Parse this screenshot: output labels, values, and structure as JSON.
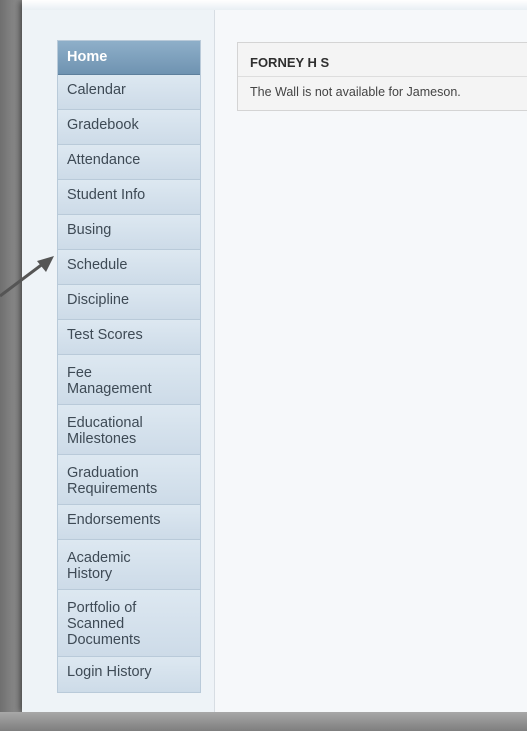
{
  "sidebar": {
    "items": [
      {
        "label": "Home",
        "active": true
      },
      {
        "label": "Calendar"
      },
      {
        "label": "Gradebook"
      },
      {
        "label": "Attendance"
      },
      {
        "label": "Student Info"
      },
      {
        "label": "Busing"
      },
      {
        "label": "Schedule"
      },
      {
        "label": "Discipline"
      },
      {
        "label": "Test Scores"
      },
      {
        "label": "Fee\nManagement"
      },
      {
        "label": "Educational\nMilestones"
      },
      {
        "label": "Graduation\nRequirements"
      },
      {
        "label": "Endorsements"
      },
      {
        "label": "Academic\nHistory"
      },
      {
        "label": "Portfolio of\nScanned\nDocuments"
      },
      {
        "label": "Login History"
      }
    ]
  },
  "main": {
    "school_name": "FORNEY H S",
    "wall_message": "The Wall is not available for Jameson."
  },
  "annotation": {
    "arrow_icon": "arrow-pointing-to-schedule",
    "arrow_color": "#555555"
  }
}
